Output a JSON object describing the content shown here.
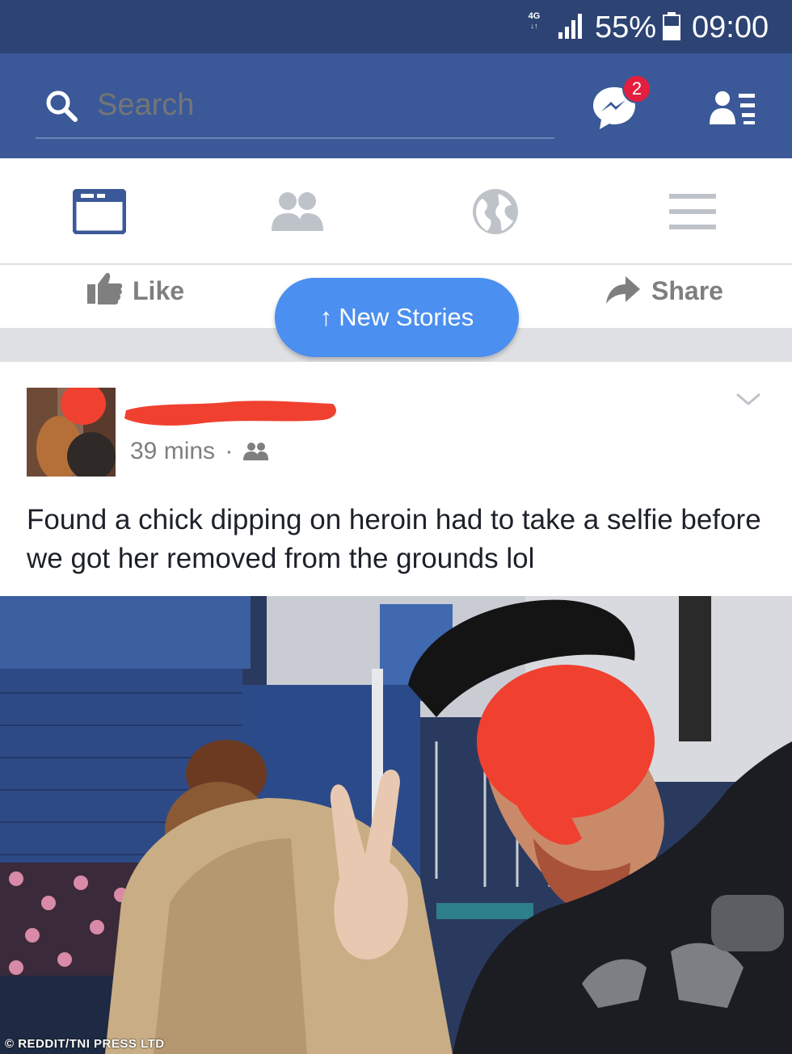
{
  "status_bar": {
    "network_type": "4G",
    "battery_percent": "55%",
    "time": "09:00",
    "icons": [
      "network-icon",
      "signal-icon",
      "battery-icon"
    ]
  },
  "search": {
    "placeholder": "Search",
    "messenger_badge": "2"
  },
  "nav_tabs": [
    {
      "name": "news-feed",
      "active": true
    },
    {
      "name": "friends",
      "active": false
    },
    {
      "name": "notifications",
      "active": false
    },
    {
      "name": "menu",
      "active": false
    }
  ],
  "actions": {
    "like_label": "Like",
    "share_label": "Share",
    "new_stories_label": "New Stories"
  },
  "post": {
    "timestamp": "39 mins",
    "separator": "·",
    "body": "Found a chick dipping on heroin had to take a selfie before we got her removed from the grounds lol"
  },
  "photo": {
    "watermark": "© REDDIT/TNI PRESS LTD"
  },
  "colors": {
    "status_bar": "#2d4373",
    "header_blue": "#3b5998",
    "active_tab": "#3b5998",
    "inactive_icon": "#bec3c9",
    "new_stories_pill": "#4b8ff0",
    "badge_red": "#e41e3f",
    "redaction_red": "#f04030"
  }
}
